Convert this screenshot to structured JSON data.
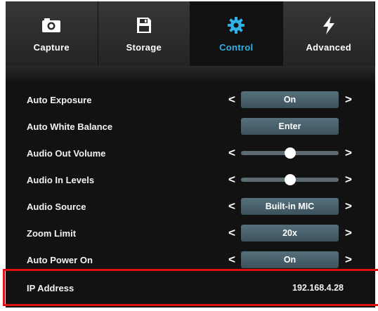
{
  "tabs": [
    {
      "label": "Capture",
      "icon": "camera-icon",
      "active": false
    },
    {
      "label": "Storage",
      "icon": "floppy-disk-icon",
      "active": false
    },
    {
      "label": "Control",
      "icon": "gear-icon",
      "active": true
    },
    {
      "label": "Advanced",
      "icon": "lightning-bolt-icon",
      "active": false
    }
  ],
  "settings": {
    "auto_exposure": {
      "label": "Auto Exposure",
      "value": "On"
    },
    "auto_white_balance": {
      "label": "Auto White Balance",
      "button": "Enter"
    },
    "audio_out_volume": {
      "label": "Audio Out Volume",
      "level_fraction": 0.5
    },
    "audio_in_levels": {
      "label": "Audio In Levels",
      "level_fraction": 0.5
    },
    "audio_source": {
      "label": "Audio Source",
      "value": "Built-in MIC"
    },
    "zoom_limit": {
      "label": "Zoom Limit",
      "value": "20x"
    },
    "auto_power_on": {
      "label": "Auto Power On",
      "value": "On"
    },
    "ip_address": {
      "label": "IP Address",
      "value": "192.168.4.28"
    }
  },
  "arrows": {
    "left": "<",
    "right": ">"
  },
  "colors": {
    "background": "#121212",
    "active_tab": "#2fb3e6",
    "pill": "#4a616b",
    "highlight_box": "#e01010"
  }
}
